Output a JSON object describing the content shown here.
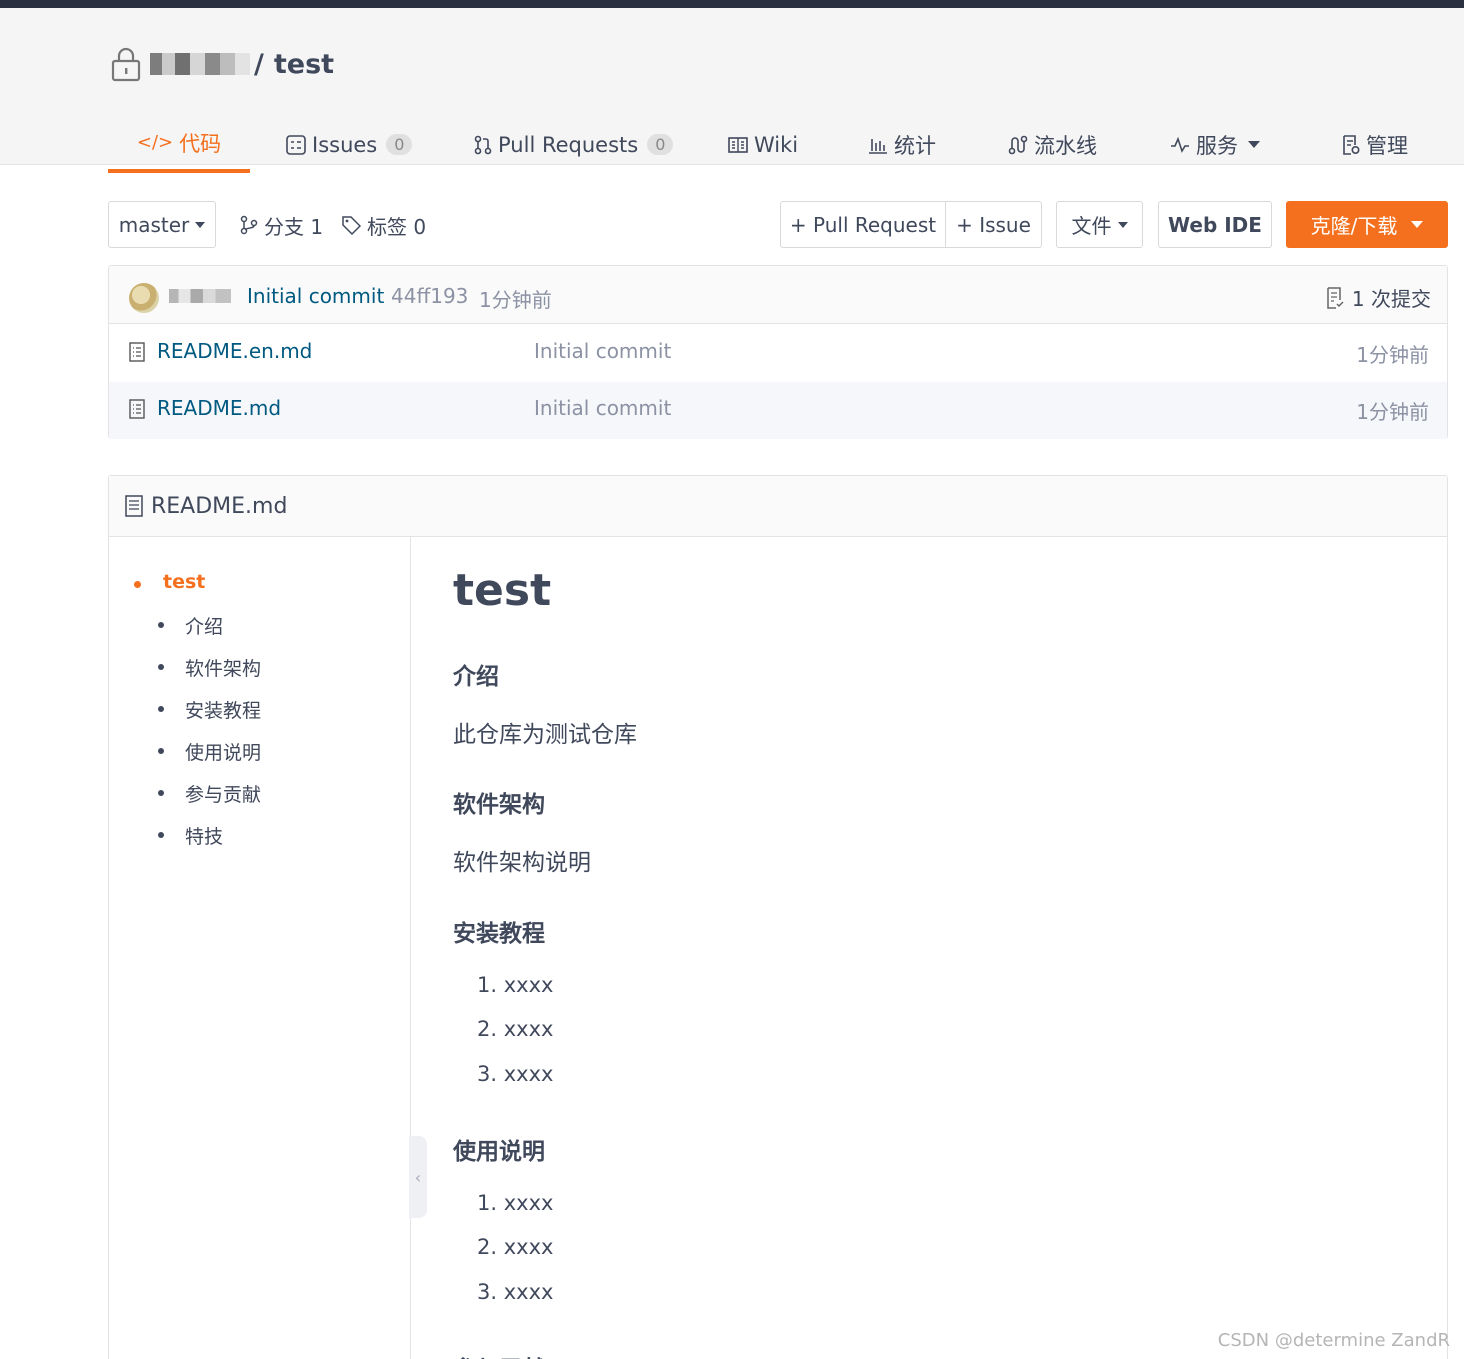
{
  "repo": {
    "owner": "",
    "separator": "/",
    "name": "test"
  },
  "tabs": [
    {
      "label": "代码",
      "icon": "code-icon",
      "active": true
    },
    {
      "label": "Issues",
      "icon": "issues-icon",
      "count": "0"
    },
    {
      "label": "Pull Requests",
      "icon": "pull-request-icon",
      "count": "0"
    },
    {
      "label": "Wiki",
      "icon": "wiki-icon"
    },
    {
      "label": "统计",
      "icon": "chart-icon"
    },
    {
      "label": "流水线",
      "icon": "pipeline-icon"
    },
    {
      "label": "服务",
      "icon": "pulse-icon",
      "dropdown": true
    },
    {
      "label": "管理",
      "icon": "settings-doc-icon"
    }
  ],
  "toolbar": {
    "branch": "master",
    "branches_label": "分支 1",
    "tags_label": "标签 0",
    "new_pr": "+ Pull Request",
    "new_issue": "+ Issue",
    "file_menu": "文件",
    "web_ide": "Web IDE",
    "clone": "克隆/下载"
  },
  "commit": {
    "message": "Initial commit",
    "sha": "44ff193",
    "time": "1分钟前",
    "count_label": "1 次提交"
  },
  "files": [
    {
      "name": "README.en.md",
      "message": "Initial commit",
      "time": "1分钟前"
    },
    {
      "name": "README.md",
      "message": "Initial commit",
      "time": "1分钟前"
    }
  ],
  "readme": {
    "filename": "README.md",
    "toc": [
      "test",
      "介绍",
      "软件架构",
      "安装教程",
      "使用说明",
      "参与贡献",
      "特技"
    ],
    "title": "test",
    "sections": {
      "intro_h": "介绍",
      "intro_p": "此仓库为测试仓库",
      "arch_h": "软件架构",
      "arch_p": "软件架构说明",
      "install_h": "安装教程",
      "install_items": [
        "1. xxxx",
        "2. xxxx",
        "3. xxxx"
      ],
      "usage_h": "使用说明",
      "usage_items": [
        "1. xxxx",
        "2. xxxx",
        "3. xxxx"
      ],
      "contrib_h": "参与贡献"
    }
  },
  "watermark": "CSDN @determine  ZandR",
  "colors": {
    "accent": "#f4701f",
    "link": "#005980",
    "topbar": "#2b3040"
  }
}
